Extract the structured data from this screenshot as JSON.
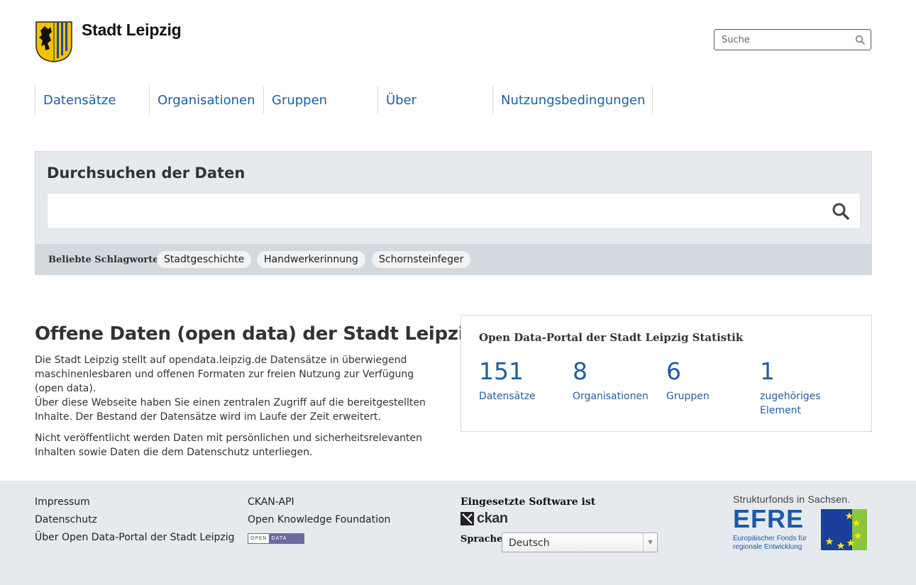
{
  "header": {
    "site_title": "Stadt Leipzig",
    "logo_icon": "leipzig-coat-of-arms-icon",
    "search_placeholder": "Suche"
  },
  "nav": {
    "items": [
      {
        "label": "Datensätze"
      },
      {
        "label": "Organisationen"
      },
      {
        "label": "Gruppen"
      },
      {
        "label": "Über"
      },
      {
        "label": "Nutzungsbedingungen"
      }
    ]
  },
  "hero": {
    "title": "Durchsuchen der Daten",
    "search_value": "",
    "tags_label": "Beliebte Schlagworte",
    "tags": [
      "Stadtgeschichte",
      "Handwerkerinnung",
      "Schornsteinfeger"
    ]
  },
  "intro": {
    "title": "Offene Daten (open data) der Stadt Leipzig",
    "paragraph1": "Die Stadt Leipzig stellt auf opendata.leipzig.de Datensätze in überwiegend maschinenlesbaren und offenen Formaten zur freien Nutzung zur Verfügung (open data).",
    "paragraph2": "Über diese Webseite haben Sie einen zentralen Zugriff auf die bereitgestellten Inhalte. Der Bestand der Datensätze wird im Laufe der Zeit erweitert.",
    "paragraph3": "Nicht veröffentlicht werden Daten mit persönlichen und sicherheitsrelevanten Inhalten sowie Daten die dem Datenschutz unterliegen."
  },
  "stats": {
    "title": "Open Data-Portal der Stadt Leipzig Statistik",
    "items": [
      {
        "number": "151",
        "label": "Datensätze"
      },
      {
        "number": "8",
        "label": "Organisationen"
      },
      {
        "number": "6",
        "label": "Gruppen"
      },
      {
        "number": "1",
        "label": "zugehöriges Element"
      }
    ]
  },
  "footer": {
    "links_col1": [
      "Impressum",
      "Datenschutz",
      "Über Open Data-Portal der Stadt Leipzig"
    ],
    "links_col2": [
      "CKAN-API",
      "Open Knowledge Foundation"
    ],
    "open_data_badge": {
      "left": "OPEN",
      "right": "DATA"
    },
    "software_label": "Eingesetzte Software ist",
    "software_name": "ckan",
    "language_label": "Sprache:",
    "language_value": "Deutsch",
    "efre_caption": "Strukturfonds in Sachsen.",
    "efre_word": "EFRE",
    "efre_sub": "Europäischer Fonds für regionale Entwicklung"
  },
  "colors": {
    "link_blue": "#1f5fa0",
    "hero_bg": "#e6eaee",
    "tags_bar_bg": "#d2d9df",
    "footer_bg": "#e6eaee",
    "efre_blue": "#1a5aa8"
  }
}
